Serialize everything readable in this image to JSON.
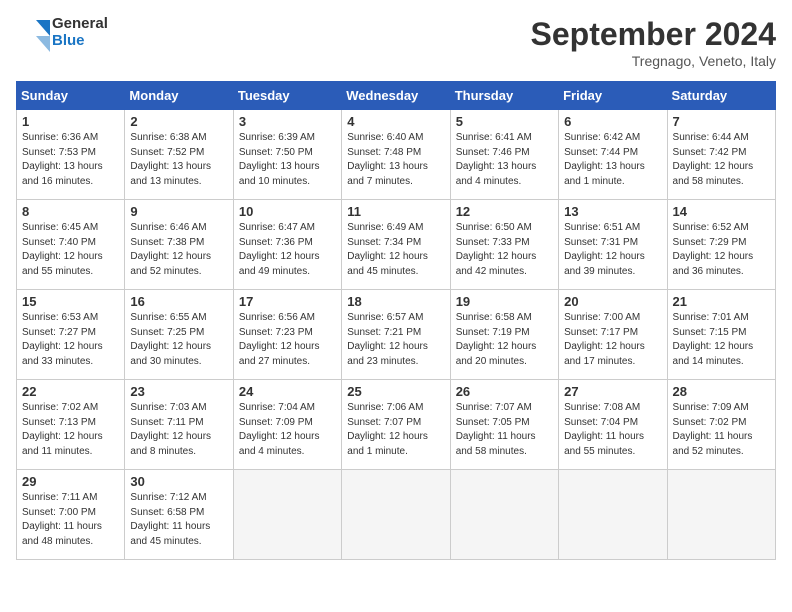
{
  "header": {
    "logo_line1": "General",
    "logo_line2": "Blue",
    "month_title": "September 2024",
    "location": "Tregnago, Veneto, Italy"
  },
  "weekdays": [
    "Sunday",
    "Monday",
    "Tuesday",
    "Wednesday",
    "Thursday",
    "Friday",
    "Saturday"
  ],
  "days": [
    {
      "num": "",
      "info": ""
    },
    {
      "num": "",
      "info": ""
    },
    {
      "num": "",
      "info": ""
    },
    {
      "num": "",
      "info": ""
    },
    {
      "num": "",
      "info": ""
    },
    {
      "num": "",
      "info": ""
    },
    {
      "num": "1",
      "info": "Sunrise: 6:36 AM\nSunset: 7:53 PM\nDaylight: 13 hours\nand 16 minutes."
    },
    {
      "num": "2",
      "info": "Sunrise: 6:38 AM\nSunset: 7:52 PM\nDaylight: 13 hours\nand 13 minutes."
    },
    {
      "num": "3",
      "info": "Sunrise: 6:39 AM\nSunset: 7:50 PM\nDaylight: 13 hours\nand 10 minutes."
    },
    {
      "num": "4",
      "info": "Sunrise: 6:40 AM\nSunset: 7:48 PM\nDaylight: 13 hours\nand 7 minutes."
    },
    {
      "num": "5",
      "info": "Sunrise: 6:41 AM\nSunset: 7:46 PM\nDaylight: 13 hours\nand 4 minutes."
    },
    {
      "num": "6",
      "info": "Sunrise: 6:42 AM\nSunset: 7:44 PM\nDaylight: 13 hours\nand 1 minute."
    },
    {
      "num": "7",
      "info": "Sunrise: 6:44 AM\nSunset: 7:42 PM\nDaylight: 12 hours\nand 58 minutes."
    },
    {
      "num": "8",
      "info": "Sunrise: 6:45 AM\nSunset: 7:40 PM\nDaylight: 12 hours\nand 55 minutes."
    },
    {
      "num": "9",
      "info": "Sunrise: 6:46 AM\nSunset: 7:38 PM\nDaylight: 12 hours\nand 52 minutes."
    },
    {
      "num": "10",
      "info": "Sunrise: 6:47 AM\nSunset: 7:36 PM\nDaylight: 12 hours\nand 49 minutes."
    },
    {
      "num": "11",
      "info": "Sunrise: 6:49 AM\nSunset: 7:34 PM\nDaylight: 12 hours\nand 45 minutes."
    },
    {
      "num": "12",
      "info": "Sunrise: 6:50 AM\nSunset: 7:33 PM\nDaylight: 12 hours\nand 42 minutes."
    },
    {
      "num": "13",
      "info": "Sunrise: 6:51 AM\nSunset: 7:31 PM\nDaylight: 12 hours\nand 39 minutes."
    },
    {
      "num": "14",
      "info": "Sunrise: 6:52 AM\nSunset: 7:29 PM\nDaylight: 12 hours\nand 36 minutes."
    },
    {
      "num": "15",
      "info": "Sunrise: 6:53 AM\nSunset: 7:27 PM\nDaylight: 12 hours\nand 33 minutes."
    },
    {
      "num": "16",
      "info": "Sunrise: 6:55 AM\nSunset: 7:25 PM\nDaylight: 12 hours\nand 30 minutes."
    },
    {
      "num": "17",
      "info": "Sunrise: 6:56 AM\nSunset: 7:23 PM\nDaylight: 12 hours\nand 27 minutes."
    },
    {
      "num": "18",
      "info": "Sunrise: 6:57 AM\nSunset: 7:21 PM\nDaylight: 12 hours\nand 23 minutes."
    },
    {
      "num": "19",
      "info": "Sunrise: 6:58 AM\nSunset: 7:19 PM\nDaylight: 12 hours\nand 20 minutes."
    },
    {
      "num": "20",
      "info": "Sunrise: 7:00 AM\nSunset: 7:17 PM\nDaylight: 12 hours\nand 17 minutes."
    },
    {
      "num": "21",
      "info": "Sunrise: 7:01 AM\nSunset: 7:15 PM\nDaylight: 12 hours\nand 14 minutes."
    },
    {
      "num": "22",
      "info": "Sunrise: 7:02 AM\nSunset: 7:13 PM\nDaylight: 12 hours\nand 11 minutes."
    },
    {
      "num": "23",
      "info": "Sunrise: 7:03 AM\nSunset: 7:11 PM\nDaylight: 12 hours\nand 8 minutes."
    },
    {
      "num": "24",
      "info": "Sunrise: 7:04 AM\nSunset: 7:09 PM\nDaylight: 12 hours\nand 4 minutes."
    },
    {
      "num": "25",
      "info": "Sunrise: 7:06 AM\nSunset: 7:07 PM\nDaylight: 12 hours\nand 1 minute."
    },
    {
      "num": "26",
      "info": "Sunrise: 7:07 AM\nSunset: 7:05 PM\nDaylight: 11 hours\nand 58 minutes."
    },
    {
      "num": "27",
      "info": "Sunrise: 7:08 AM\nSunset: 7:04 PM\nDaylight: 11 hours\nand 55 minutes."
    },
    {
      "num": "28",
      "info": "Sunrise: 7:09 AM\nSunset: 7:02 PM\nDaylight: 11 hours\nand 52 minutes."
    },
    {
      "num": "29",
      "info": "Sunrise: 7:11 AM\nSunset: 7:00 PM\nDaylight: 11 hours\nand 48 minutes."
    },
    {
      "num": "30",
      "info": "Sunrise: 7:12 AM\nSunset: 6:58 PM\nDaylight: 11 hours\nand 45 minutes."
    },
    {
      "num": "",
      "info": ""
    },
    {
      "num": "",
      "info": ""
    },
    {
      "num": "",
      "info": ""
    },
    {
      "num": "",
      "info": ""
    },
    {
      "num": "",
      "info": ""
    }
  ]
}
